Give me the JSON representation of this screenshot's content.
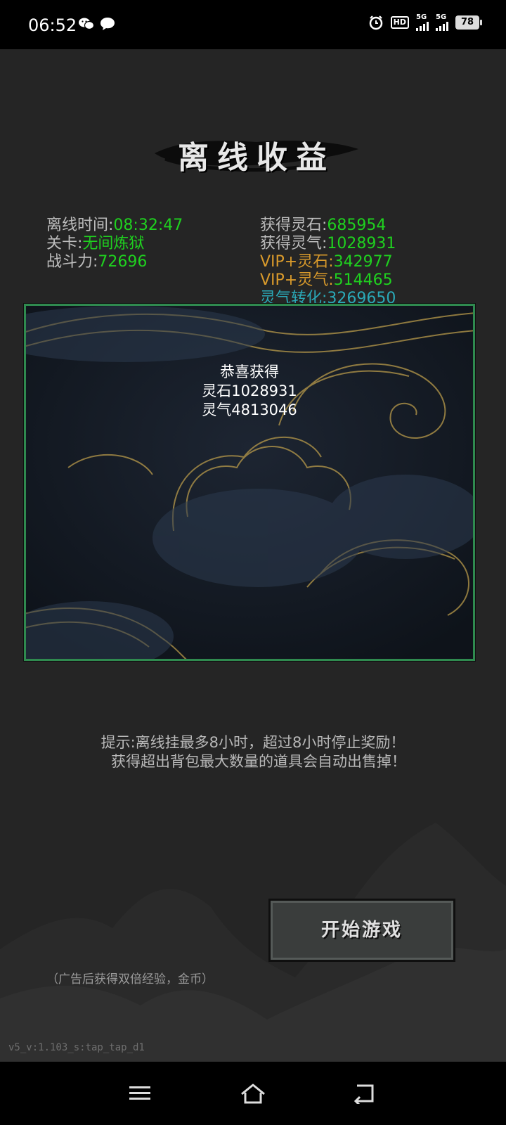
{
  "status_bar": {
    "time": "06:52",
    "left_icons": [
      "wechat-icon",
      "message-bubble-icon"
    ],
    "hd_label": "HD",
    "sim1_label": "5G",
    "sim2_label": "5G",
    "battery": "78"
  },
  "title": "离线收益",
  "stats_left": [
    {
      "label": "离线时间:",
      "value": "08:32:47"
    },
    {
      "label": "关卡:",
      "value": "无间炼狱"
    },
    {
      "label": "战斗力:",
      "value": "72696"
    }
  ],
  "stats_right": [
    {
      "label": "获得灵石:",
      "value": "685954"
    },
    {
      "label": "获得灵气:",
      "value": "1028931"
    },
    {
      "label": "VIP+灵石:",
      "value": "342977"
    },
    {
      "label": "VIP+灵气:",
      "value": "514465"
    },
    {
      "label": "灵气转化:",
      "value": "3269650"
    }
  ],
  "reward_popup": {
    "heading": "恭喜获得",
    "line1": "灵石1028931",
    "line2": "灵气4813046"
  },
  "tips": [
    "提示:离线挂最多8小时，超过8小时停止奖励！",
    "获得超出背包最大数量的道具会自动出售掉！"
  ],
  "start_button": "开始游戏",
  "ad_note": "（广告后获得双倍经验，金币）",
  "version": "v5_v:1.103_s:tap_tap_d1",
  "nav": [
    "menu-icon",
    "home-icon",
    "back-icon"
  ],
  "colors": {
    "value_green": "#1fd11f",
    "vip_orange": "#d99a2b",
    "convert_cyan": "#2aa9b8",
    "panel_border": "#2f8a4f"
  }
}
